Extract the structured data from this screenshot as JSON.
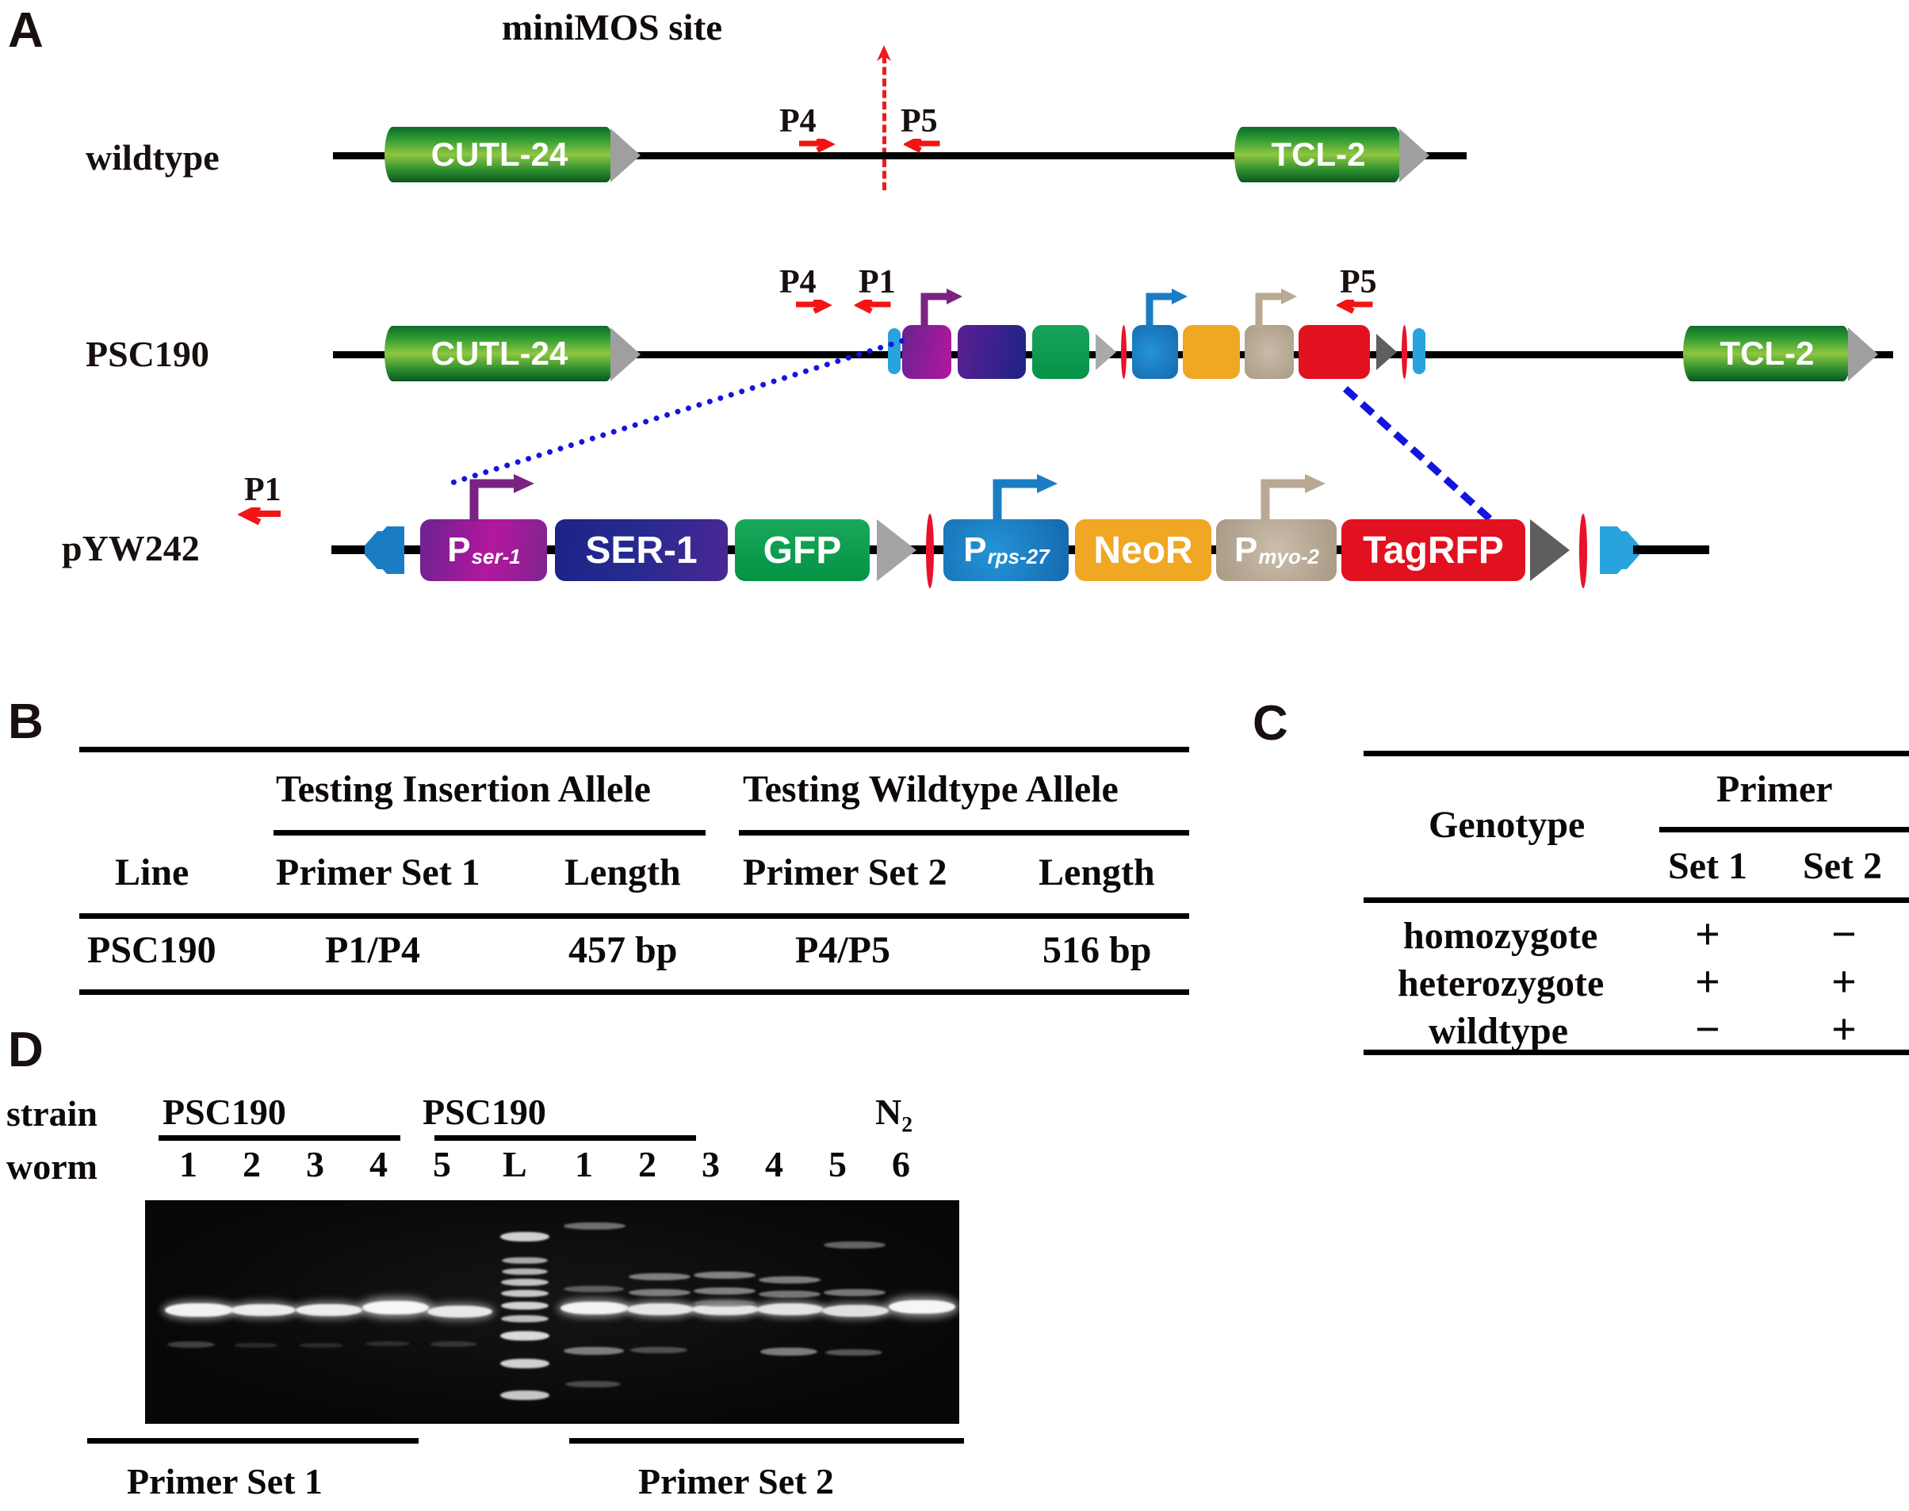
{
  "panels": {
    "a": "A",
    "b": "B",
    "c": "C",
    "d": "D"
  },
  "panelA": {
    "minimos_label": "miniMOS site",
    "rows": [
      {
        "name": "wildtype",
        "genes": [
          {
            "label": "CUTL-24"
          },
          {
            "label": "TCL-2"
          }
        ],
        "primers": [
          {
            "label": "P4",
            "dir": "right"
          },
          {
            "label": "P5",
            "dir": "left"
          }
        ]
      },
      {
        "name": "PSC190",
        "genes": [
          {
            "label": "CUTL-24"
          },
          {
            "label": "TCL-2"
          }
        ],
        "primers": [
          {
            "label": "P4",
            "dir": "right"
          },
          {
            "label": "P1",
            "dir": "left"
          },
          {
            "label": "P5",
            "dir": "left"
          }
        ]
      },
      {
        "name": "pYW242",
        "primers": [
          {
            "label": "P1",
            "dir": "left"
          }
        ],
        "elements": [
          {
            "label": "P",
            "sub": "ser-1",
            "color": "purple"
          },
          {
            "label": "SER-1",
            "sub": "",
            "color": "navy"
          },
          {
            "label": "GFP",
            "sub": "",
            "color": "green"
          },
          {
            "label": "P",
            "sub": "rps-27",
            "color": "blue"
          },
          {
            "label": "NeoR",
            "sub": "",
            "color": "orange"
          },
          {
            "label": "P",
            "sub": "myo-2",
            "color": "tan"
          },
          {
            "label": "TagRFP",
            "sub": "",
            "color": "red"
          }
        ]
      }
    ]
  },
  "panelB": {
    "group_headers": [
      "Testing Insertion Allele",
      "Testing Wildtype Allele"
    ],
    "columns": [
      "Line",
      "Primer Set 1",
      "Length",
      "Primer Set 2",
      "Length"
    ],
    "rows": [
      [
        "PSC190",
        "P1/P4",
        "457 bp",
        "P4/P5",
        "516 bp"
      ]
    ]
  },
  "panelC": {
    "group_header": "Primer",
    "columns": [
      "Genotype",
      "Set 1",
      "Set 2"
    ],
    "rows": [
      [
        "homozygote",
        "+",
        "−"
      ],
      [
        "heterozygote",
        "+",
        "+"
      ],
      [
        "wildtype",
        "−",
        "+"
      ]
    ]
  },
  "panelD": {
    "row_labels": [
      "strain",
      "worm"
    ],
    "strain_groups": [
      {
        "label": "PSC190",
        "underline": true
      },
      {
        "label": "PSC190",
        "underline": true
      },
      {
        "label": "N₂",
        "underline": false
      }
    ],
    "lanes": [
      "1",
      "2",
      "3",
      "4",
      "5",
      "L",
      "1",
      "2",
      "3",
      "4",
      "5",
      "6"
    ],
    "bottom_groups": [
      "Primer Set 1",
      "Primer Set 2"
    ]
  },
  "colors": {
    "gene_green": "#2f9b33",
    "promoter_purple": "#7a2382",
    "ser1_navy": "#21237f",
    "gfp_green": "#05a04e",
    "prps_blue": "#1a7dc4",
    "neor_orange": "#f5a623",
    "pmyo_tan": "#b9a894",
    "tagrfp_red": "#e2111f",
    "primer_red": "#f21414",
    "link_blue": "#1414e0",
    "lox_cyan": "#29a3dd",
    "gray_arrow": "#9f9f9f"
  }
}
